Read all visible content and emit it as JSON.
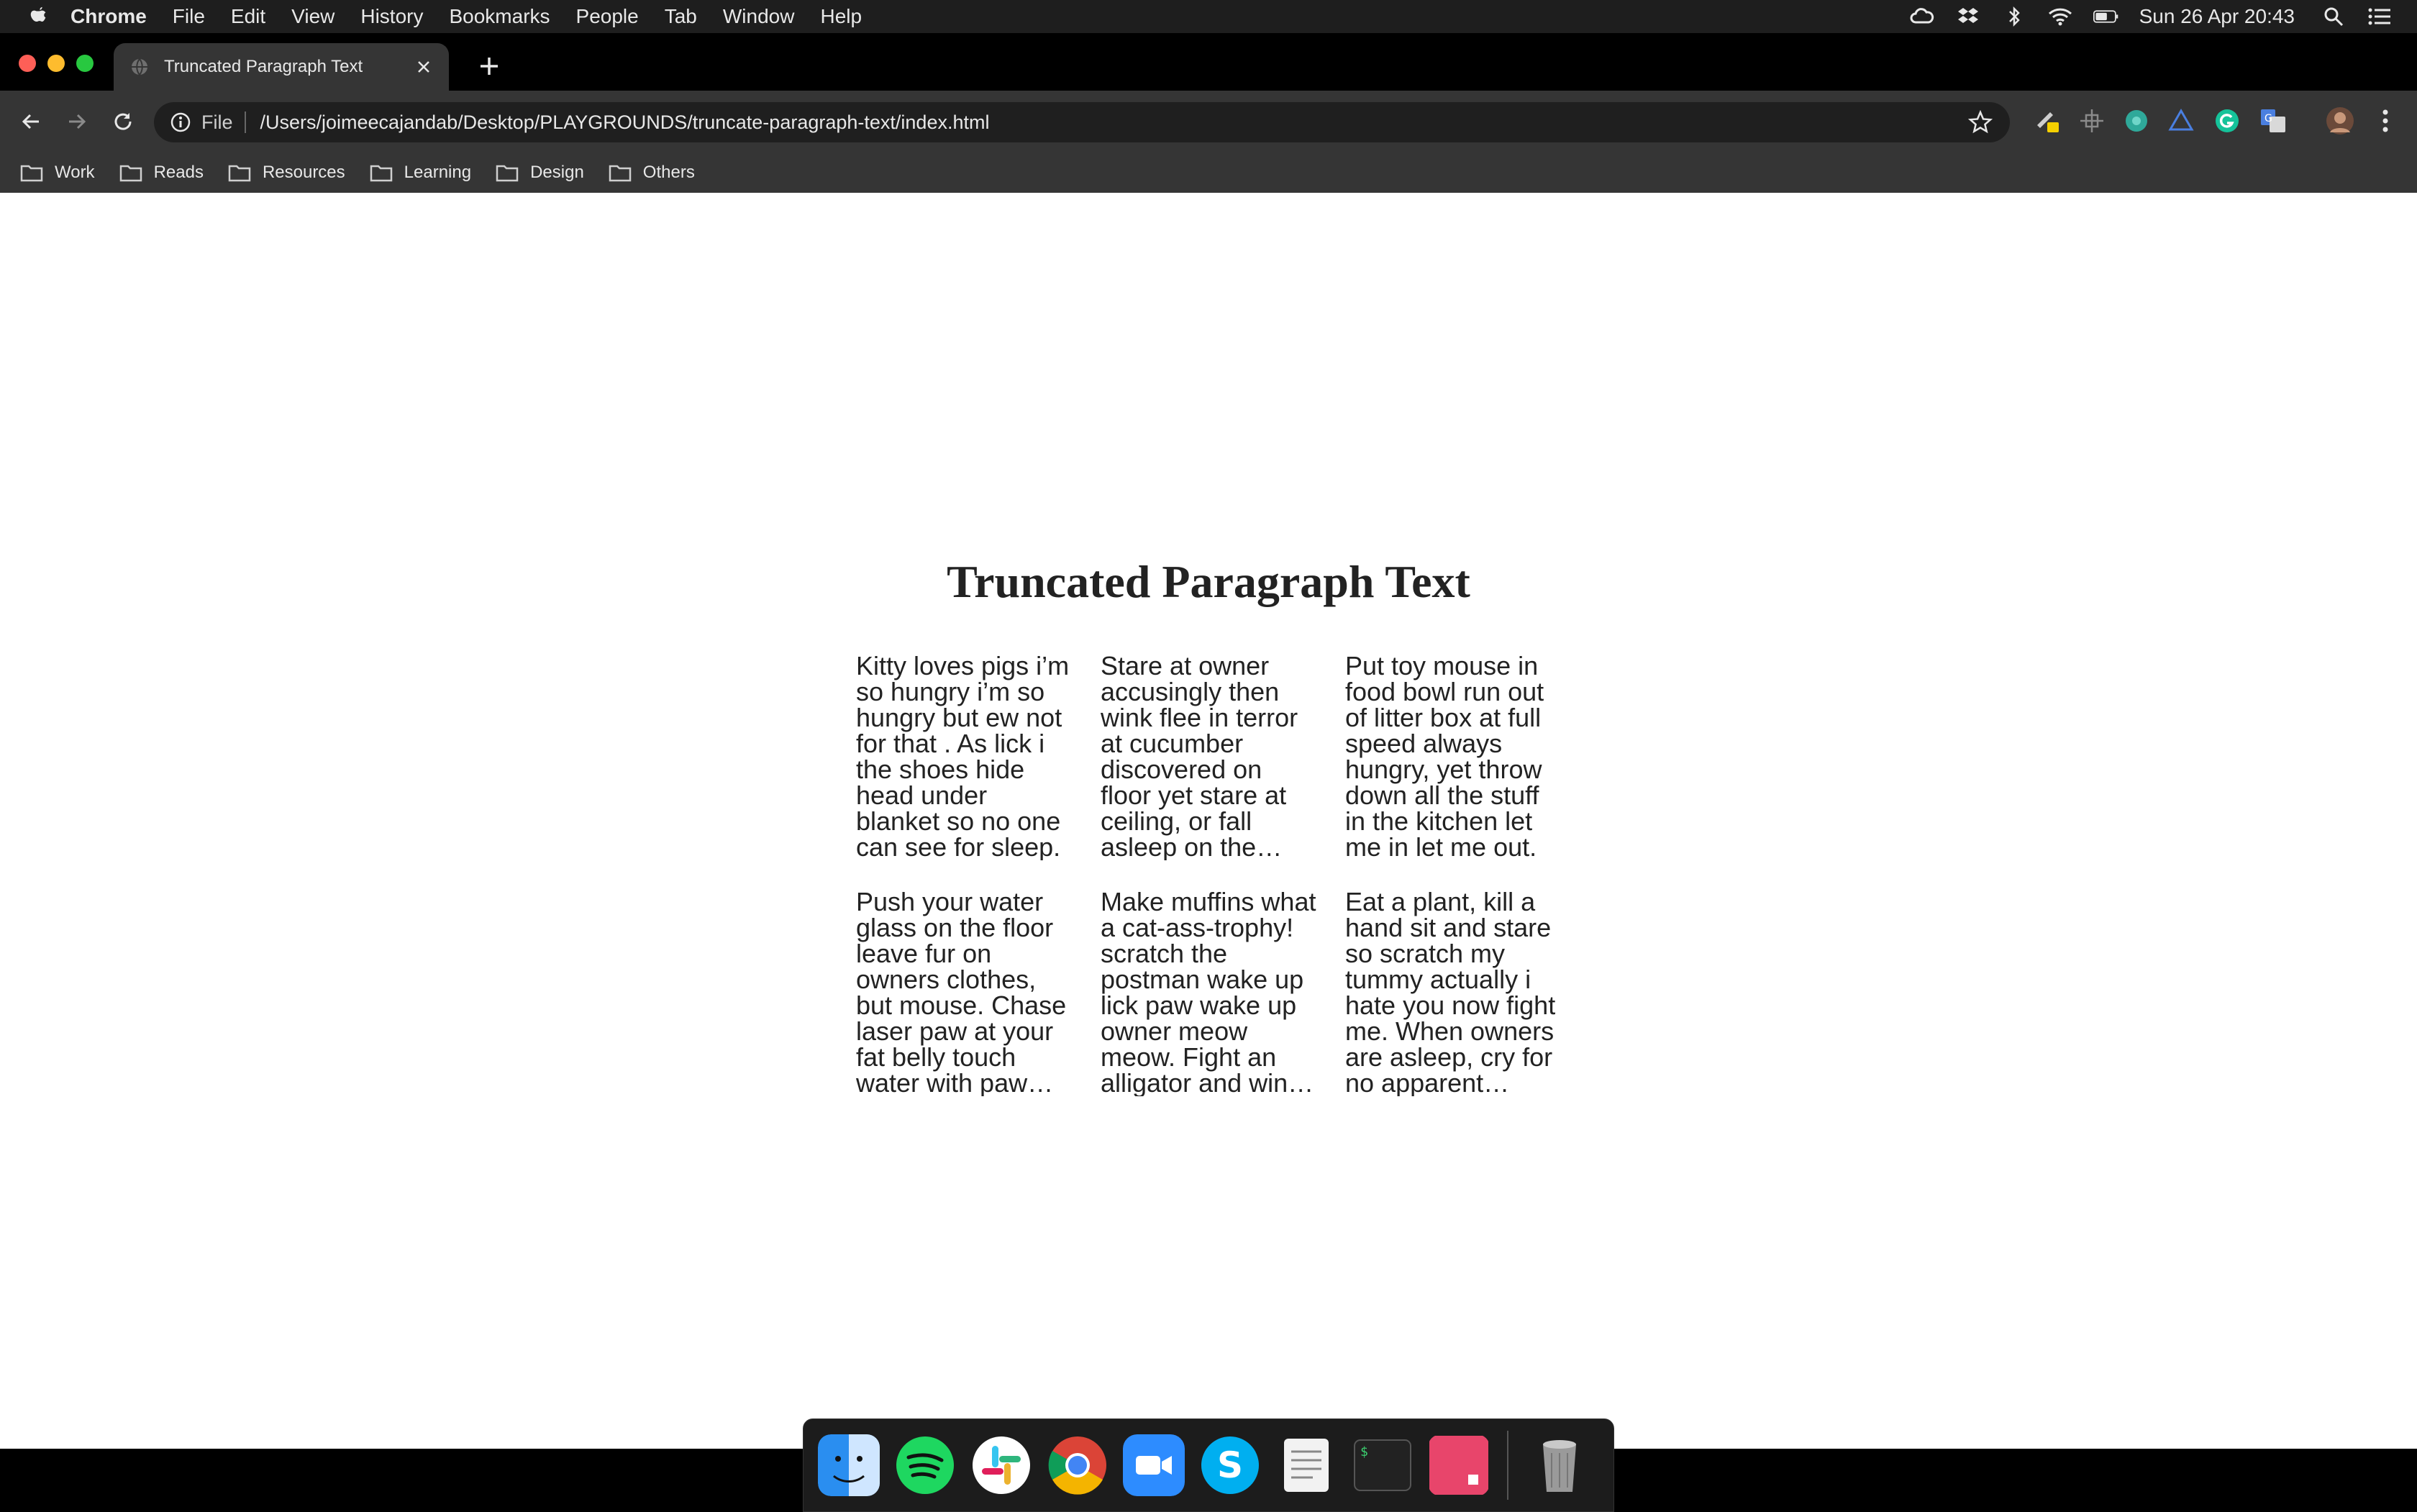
{
  "menubar": {
    "app_name": "Chrome",
    "items": [
      "File",
      "Edit",
      "View",
      "History",
      "Bookmarks",
      "People",
      "Tab",
      "Window",
      "Help"
    ],
    "clock": "Sun 26 Apr  20:43"
  },
  "tab": {
    "title": "Truncated Paragraph Text"
  },
  "omnibox": {
    "scheme_label": "File",
    "url": "/Users/joimeecajandab/Desktop/PLAYGROUNDS/truncate-paragraph-text/index.html"
  },
  "bookmarks": [
    "Work",
    "Reads",
    "Resources",
    "Learning",
    "Design",
    "Others"
  ],
  "page": {
    "title": "Truncated Paragraph Text",
    "paragraphs": [
      "Kitty loves pigs i’m so hungry i’m so hungry but ew not for that . As lick i the shoes hide head under blanket so no one can see for sleep.",
      "Stare at owner accusingly then wink flee in terror at cucumber discovered on floor yet stare at ceiling, or fall asleep on the sofa.",
      "Put toy mouse in food bowl run out of litter box at full speed always hungry, yet throw down all the stuff in the kitchen let me in let me out.",
      "Push your water glass on the floor leave fur on owners clothes, but mouse. Chase laser paw at your fat belly touch water with paw then.",
      "Make muffins what a cat-ass-trophy! scratch the postman wake up lick paw wake up owner meow meow. Fight an alligator and win again.",
      "Eat a plant, kill a hand sit and stare so scratch my tummy actually i hate you now fight me. When owners are asleep, cry for no apparent reason."
    ]
  },
  "colors": {
    "menubar_bg": "#1e1e1e",
    "toolbar_bg": "#353535",
    "tab_active_bg": "#353535",
    "omnibox_bg": "#1f1f1f",
    "page_bg": "#ffffff",
    "text": "#222222"
  },
  "icons": {
    "status": [
      "creative-cloud-icon",
      "dropbox-icon",
      "bluetooth-icon",
      "wifi-icon",
      "battery-icon"
    ],
    "dock": [
      "finder-icon",
      "spotify-icon",
      "slack-icon",
      "chrome-icon",
      "zoom-icon",
      "skype-icon",
      "notes-icon",
      "terminal-icon",
      "app-icon",
      "trash-icon"
    ]
  }
}
